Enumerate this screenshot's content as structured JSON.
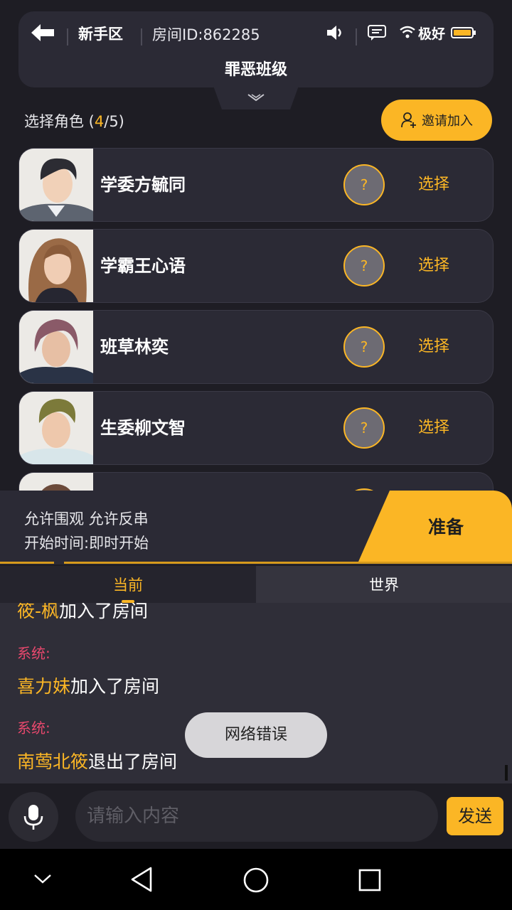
{
  "header": {
    "zone": "新手区",
    "room_id": "房间ID:862285",
    "network": "极好",
    "title": "罪恶班级"
  },
  "select": {
    "label_prefix": "选择角色 (",
    "count": "4",
    "label_suffix": "/5)",
    "invite_label": "邀请加入"
  },
  "roles": [
    {
      "name": "学委方毓同",
      "badge": "?",
      "action": "选择"
    },
    {
      "name": "学霸王心语",
      "badge": "?",
      "action": "选择"
    },
    {
      "name": "班草林奕",
      "badge": "?",
      "action": "选择"
    },
    {
      "name": "生委柳文智",
      "badge": "?",
      "action": "选择"
    }
  ],
  "info": {
    "line1": "允许围观 允许反串",
    "line2": "开始时间:即时开始",
    "ready_label": "准备"
  },
  "tabs": {
    "current": "当前",
    "world": "世界"
  },
  "chat": {
    "messages": [
      {
        "user": "筱-枫",
        "text": "加入了房间"
      },
      {
        "system": "系统:"
      },
      {
        "user": "喜力妹",
        "text": "加入了房间"
      },
      {
        "system": "系统:"
      },
      {
        "user": "南莺北筱",
        "text": "退出了房间"
      }
    ]
  },
  "toast": "网络错误",
  "input": {
    "placeholder": "请输入内容",
    "send_label": "发送"
  },
  "colors": {
    "accent": "#fbb625",
    "system_text": "#e8486d",
    "background": "#1e1d24",
    "panel": "#2b2a35"
  },
  "icons": [
    "back-arrow-icon",
    "speaker-icon",
    "message-icon",
    "wifi-icon",
    "battery-icon",
    "chevron-down-icon",
    "add-user-icon",
    "mic-icon",
    "nav-down-icon",
    "nav-back-icon",
    "nav-home-icon",
    "nav-recent-icon"
  ]
}
